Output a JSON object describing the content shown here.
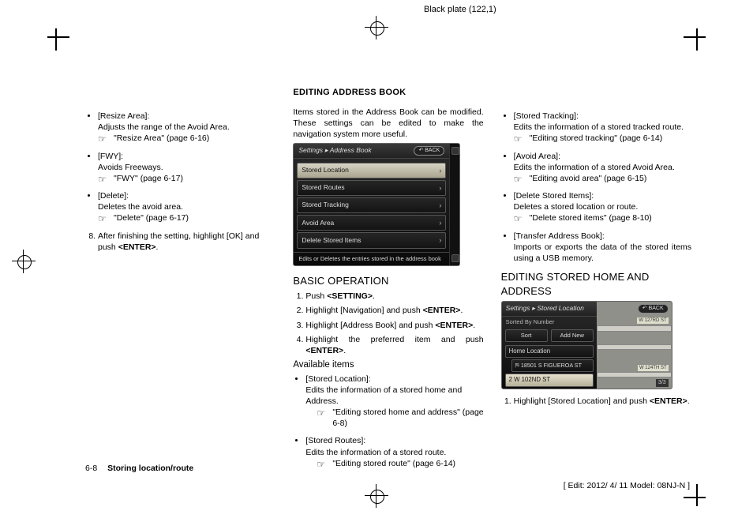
{
  "meta": {
    "plate": "Black plate (122,1)",
    "edit_line": "[ Edit: 2012/ 4/ 11   Model:  08NJ-N ]",
    "page_number": "6-8",
    "footer_title": "Storing location/route"
  },
  "col1": {
    "items": [
      {
        "label": "[Resize Area]:",
        "desc": "Adjusts the range of the Avoid Area.",
        "ref": "\"Resize Area\" (page 6-16)"
      },
      {
        "label": "[FWY]:",
        "desc": "Avoids Freeways.",
        "ref": "\"FWY\" (page 6-17)"
      },
      {
        "label": "[Delete]:",
        "desc": "Deletes the avoid area.",
        "ref": "\"Delete\" (page 6-17)"
      }
    ],
    "step8_a": "After finishing the setting, highlight [OK] and push ",
    "step8_enter": "<ENTER>",
    "step8_b": "."
  },
  "col2": {
    "title": "EDITING ADDRESS BOOK",
    "intro": "Items stored in the Address Book can be modified. These settings can be edited to make the navigation system more useful.",
    "panel": {
      "breadcrumb": "Settings ▸ Address Book",
      "back": "↶ BACK",
      "items": [
        "Stored Location",
        "Stored Routes",
        "Stored Tracking",
        "Avoid Area",
        "Delete Stored Items"
      ],
      "footer": "Edits or Deletes the entries stored in the address book"
    },
    "basic_head": "BASIC OPERATION",
    "steps": [
      {
        "a": "Push ",
        "b": "<SETTING>",
        "c": "."
      },
      {
        "a": "Highlight [Navigation] and push ",
        "b": "<ENTER>",
        "c": "."
      },
      {
        "a": "Highlight [Address Book] and push ",
        "b": "<ENTER>",
        "c": "."
      },
      {
        "a": "Highlight the preferred item and push ",
        "b": "<ENTER>",
        "c": "."
      }
    ],
    "avail_head": "Available items",
    "avail": [
      {
        "label": "[Stored Location]:",
        "desc": "Edits the information of a stored home and Address.",
        "ref": "\"Editing stored home and address\" (page 6-8)"
      },
      {
        "label": "[Stored Routes]:",
        "desc": "Edits the information of a stored route.",
        "ref": "\"Editing stored route\" (page 6-14)"
      }
    ]
  },
  "col3": {
    "items": [
      {
        "label": "[Stored Tracking]:",
        "desc": "Edits the information of a stored tracked route.",
        "ref": "\"Editing stored tracking\" (page 6-14)"
      },
      {
        "label": "[Avoid Area]:",
        "desc": "Edits the information of a stored Avoid Area.",
        "ref": "\"Editing avoid area\" (page 6-15)"
      },
      {
        "label": "[Delete Stored Items]:",
        "desc": "Deletes a stored location or route.",
        "ref": "\"Delete stored items\" (page 8-10)"
      },
      {
        "label": "[Transfer Address Book]:",
        "desc": "Imports or exports the data of the stored items using a USB memory.",
        "ref": ""
      }
    ],
    "head2": "EDITING STORED HOME AND ADDRESS",
    "panel": {
      "breadcrumb": "Settings ▸ Stored Location",
      "back": "↶ BACK",
      "sub": "Sorted By Number",
      "btn_sort": "Sort",
      "btn_add": "Add New",
      "rows": [
        "Home Location",
        "⛿ 18501 S FIGUEROA ST",
        "2 W 102ND ST"
      ],
      "map_labels": [
        "W 127RD ST",
        "W 124TH ST"
      ],
      "counter": "3/3"
    },
    "step1_a": "Highlight [Stored Location] and push ",
    "step1_b": "<ENTER>",
    "step1_c": "."
  }
}
